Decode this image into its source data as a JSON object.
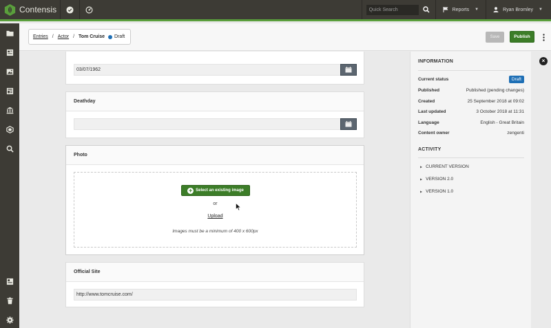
{
  "app": {
    "name": "Contensis",
    "brand_color": "#5a9f3c",
    "icons": [
      "check-circle-icon",
      "dashboard-icon"
    ]
  },
  "topnav": {
    "search_placeholder": "Quick Search",
    "search_icon": "search-icon",
    "reports_label": "Reports",
    "user_name": "Ryan Bromley"
  },
  "sidebar": {
    "items": [
      "folder-icon",
      "entries-icon",
      "image-icon",
      "content-types-icon",
      "library-icon",
      "blocks-icon",
      "search-icon"
    ],
    "bottom_items": [
      "site-view-icon",
      "trash-icon",
      "settings-icon"
    ]
  },
  "breadcrumb": {
    "items": [
      "Entries",
      "Actor"
    ],
    "current": "Tom Cruise",
    "status": "Draft"
  },
  "actions": {
    "save_label": "Save",
    "publish_label": "Publish"
  },
  "fields": {
    "birthday_value": "03/07/1962",
    "deathday_label": "Deathday",
    "deathday_value": "",
    "photo_label": "Photo",
    "select_image_label": "Select an existing image",
    "or_label": "or",
    "upload_label": "Upload",
    "image_note": "Images must be a minimum of 400 x 600px",
    "official_site_label": "Official Site",
    "official_site_value": "http://www.tomcruise.com/"
  },
  "information": {
    "title": "INFORMATION",
    "rows": [
      {
        "key": "Current status",
        "value": "Draft"
      },
      {
        "key": "Published",
        "value": "Published (pending changes)"
      },
      {
        "key": "Created",
        "value": "25 September 2018 at 09:02"
      },
      {
        "key": "Last updated",
        "value": "3 October 2018 at 11:31"
      },
      {
        "key": "Language",
        "value": "English - Great Britain"
      },
      {
        "key": "Content owner",
        "value": "zengenti"
      }
    ]
  },
  "activity": {
    "title": "ACTIVITY",
    "versions": [
      "CURRENT VERSION",
      "VERSION 2.0",
      "VERSION 1.0"
    ]
  },
  "colors": {
    "topbar": "#3d3b35",
    "publish": "#3c7d28",
    "draft_badge": "#1e6fb5",
    "save_disabled": "#b8b8b8"
  }
}
